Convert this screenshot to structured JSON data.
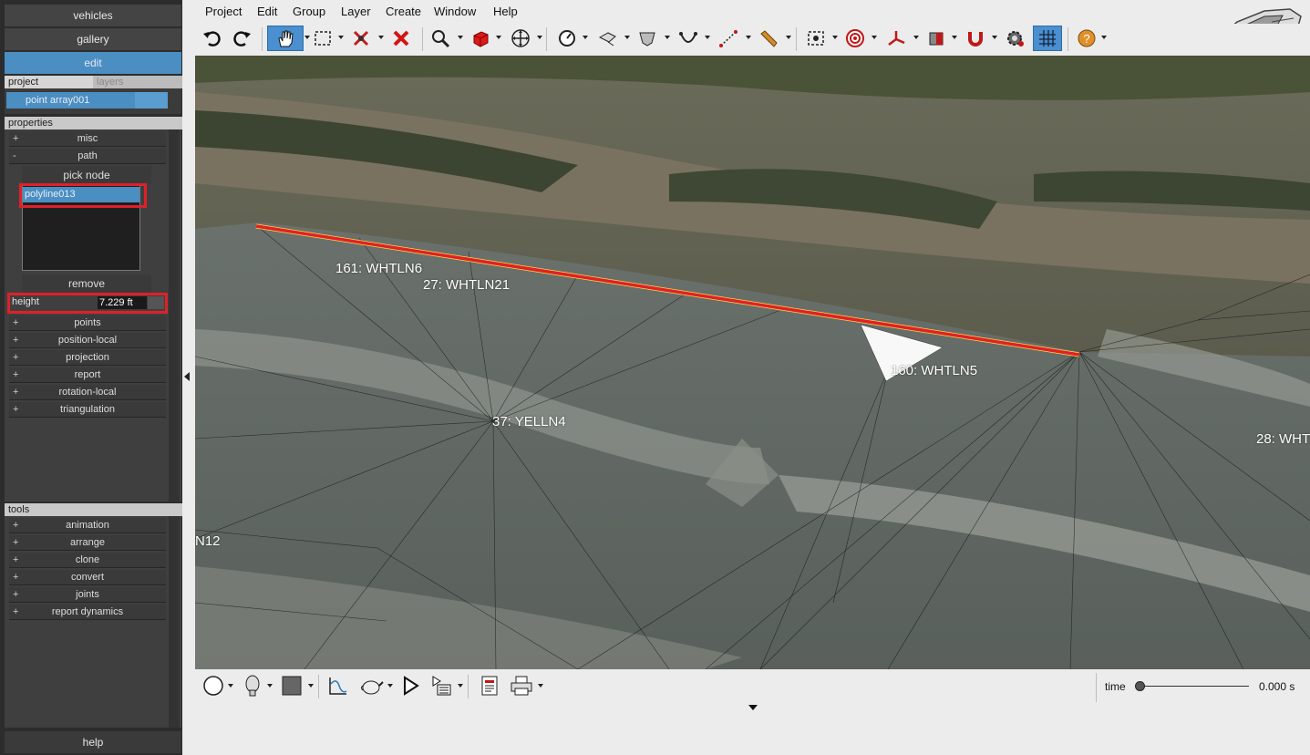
{
  "sidebar": {
    "nav": {
      "vehicles": "vehicles",
      "gallery": "gallery",
      "edit": "edit"
    },
    "tabs": {
      "project": "project",
      "layers": "layers"
    },
    "selected_object": "point array001",
    "properties_header": "properties",
    "properties": {
      "misc": {
        "sign": "+",
        "label": "misc"
      },
      "path": {
        "sign": "-",
        "label": "path"
      },
      "pick_node": "pick node",
      "path_item": "polyline013",
      "remove": "remove",
      "height_label": "height",
      "height_value": "7.229 ft",
      "rows": [
        {
          "sign": "+",
          "label": "points"
        },
        {
          "sign": "+",
          "label": "position-local"
        },
        {
          "sign": "+",
          "label": "projection"
        },
        {
          "sign": "+",
          "label": "report"
        },
        {
          "sign": "+",
          "label": "rotation-local"
        },
        {
          "sign": "+",
          "label": "triangulation"
        }
      ]
    },
    "tools_header": "tools",
    "tools": [
      {
        "sign": "+",
        "label": "animation"
      },
      {
        "sign": "+",
        "label": "arrange"
      },
      {
        "sign": "+",
        "label": "clone"
      },
      {
        "sign": "+",
        "label": "convert"
      },
      {
        "sign": "+",
        "label": "joints"
      },
      {
        "sign": "+",
        "label": "report dynamics"
      }
    ],
    "help": "help"
  },
  "menu": [
    "Project",
    "Edit",
    "Group",
    "Layer",
    "Create",
    "Window",
    "Help"
  ],
  "toolbar_icons": [
    "undo-icon",
    "redo-icon",
    "hand-pan-icon",
    "select-box-icon",
    "delete-node-icon",
    "delete-icon",
    "zoom-icon",
    "cube-icon",
    "move-icon",
    "gauge-icon",
    "surface-icon",
    "cloth-icon",
    "curve-icon",
    "measure-icon",
    "pencil-icon",
    "camera-target-icon",
    "target-icon",
    "axes-icon",
    "material-icon",
    "magnet-icon",
    "settings-icon",
    "grid-icon",
    "help-icon"
  ],
  "viewport_labels": {
    "l161": "161: WHTLN6",
    "l27": "27: WHTLN21",
    "l160": "160: WHTLN5",
    "l37": "37: YELLN4",
    "l28": "28: WHT",
    "l12": "N12"
  },
  "bottom": {
    "time_label": "time",
    "time_value": "0.000 s",
    "time_position": 0
  },
  "colors": {
    "accent_blue": "#4b8ec2",
    "highlight_red": "#e0202a",
    "panel_dark": "#2c2c2c"
  }
}
